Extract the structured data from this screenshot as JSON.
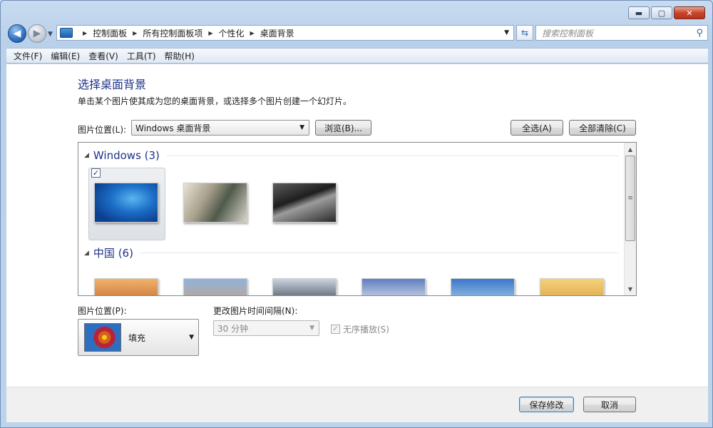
{
  "window": {
    "minimize_label": "▬",
    "maximize_label": "▢",
    "close_label": "✕"
  },
  "address_bar": {
    "crumbs": [
      "控制面板",
      "所有控制面板项",
      "个性化",
      "桌面背景"
    ],
    "search_placeholder": "搜索控制面板"
  },
  "menu": {
    "items": [
      {
        "label": "文件(F)"
      },
      {
        "label": "编辑(E)"
      },
      {
        "label": "查看(V)"
      },
      {
        "label": "工具(T)"
      },
      {
        "label": "帮助(H)"
      }
    ]
  },
  "main": {
    "title": "选择桌面背景",
    "subtitle": "单击某个图片使其成为您的桌面背景，或选择多个图片创建一个幻灯片。",
    "location_label": "图片位置(L):",
    "location_value": "Windows 桌面背景",
    "browse_label": "浏览(B)...",
    "select_all_label": "全选(A)",
    "clear_all_label": "全部清除(C)"
  },
  "gallery": {
    "groups": [
      {
        "name": "Windows (3)",
        "count": 3,
        "selected_index": 0
      },
      {
        "name": "中国 (6)",
        "count": 6
      }
    ]
  },
  "settings": {
    "position_label": "图片位置(P):",
    "position_value": "填充",
    "interval_label": "更改图片时间间隔(N):",
    "interval_value": "30 分钟",
    "shuffle_label": "无序播放(S)",
    "shuffle_checked": true,
    "shuffle_enabled": false
  },
  "footer": {
    "save_label": "保存修改",
    "cancel_label": "取消"
  }
}
